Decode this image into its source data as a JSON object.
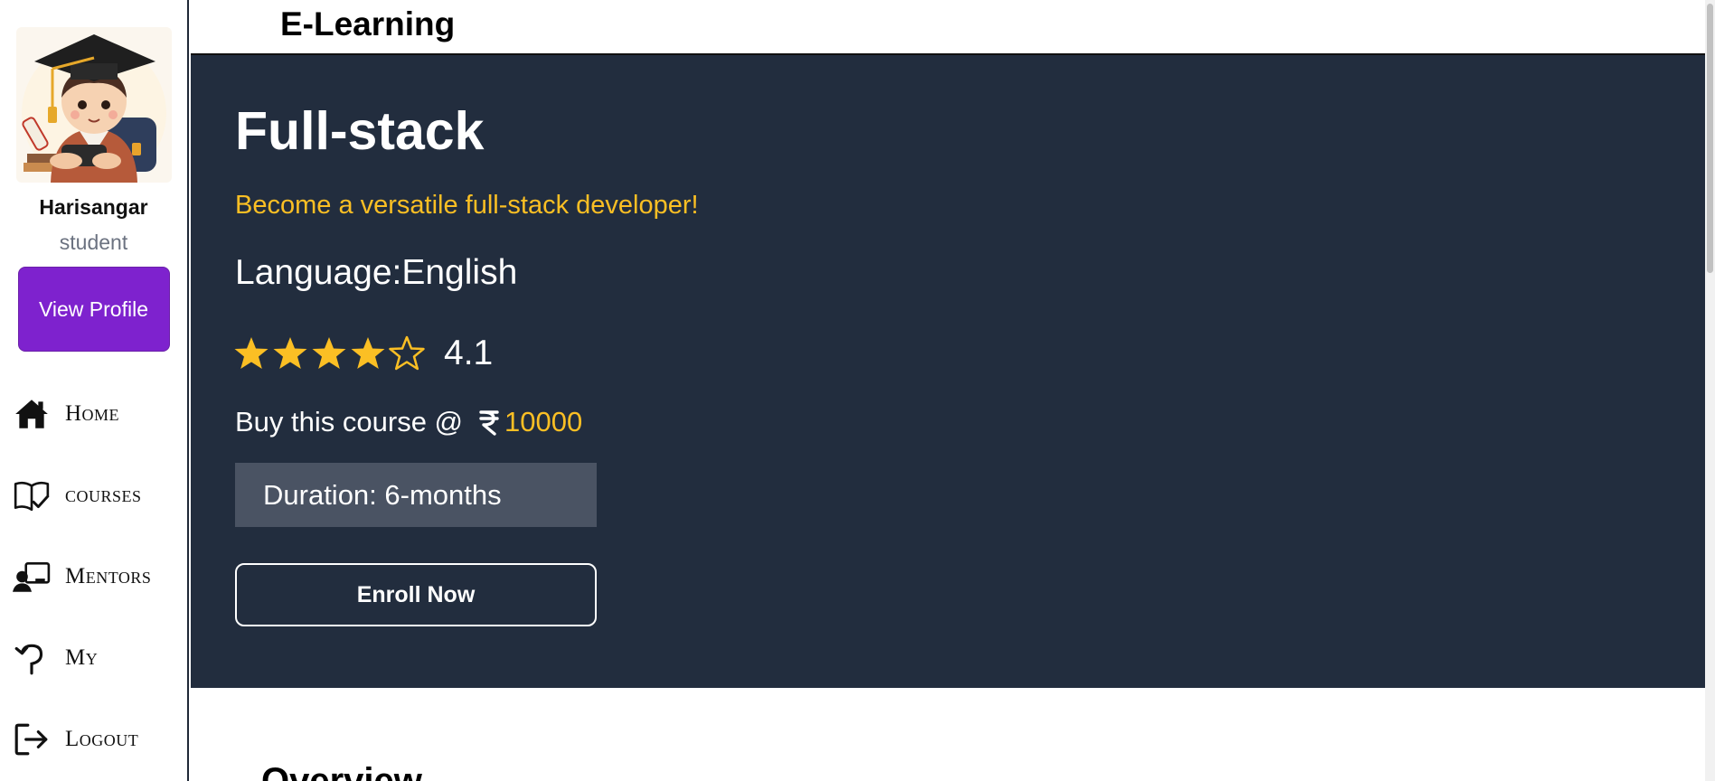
{
  "app": {
    "brand": "E-Learning"
  },
  "user": {
    "name": "Harisangar",
    "role": "student",
    "view_profile_label": "View Profile"
  },
  "nav": {
    "items": [
      {
        "label": "Home",
        "icon": "home-icon"
      },
      {
        "label": "courses",
        "icon": "book-check-icon"
      },
      {
        "label": "Mentors",
        "icon": "mentor-icon"
      },
      {
        "label": "My",
        "icon": "back-arrow-icon"
      },
      {
        "label": "Logout",
        "icon": "logout-icon"
      }
    ]
  },
  "course": {
    "title": "Full-stack",
    "tagline": "Become a versatile full-stack developer!",
    "language_label": "Language:",
    "language": "English",
    "rating": 4.1,
    "rating_display": "4.1",
    "stars_filled": 4,
    "stars_total": 5,
    "price_prefix": "Buy this course @",
    "price": "10000",
    "duration": "Duration: 6-months",
    "enroll_label": "Enroll Now"
  },
  "overview": {
    "heading": "Overview"
  },
  "colors": {
    "sidebar_button": "#7e22ce",
    "hero_bg": "#222d3e",
    "accent_yellow": "#fbbf24",
    "duration_bg": "#4a5363"
  }
}
